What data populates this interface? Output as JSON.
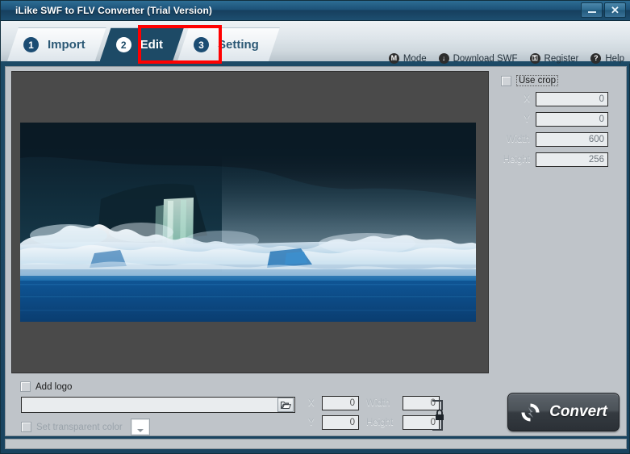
{
  "window": {
    "title": "iLike SWF to FLV Converter (Trial Version)",
    "minimize_label": "–",
    "close_label": "✕"
  },
  "tabs": [
    {
      "num": "1",
      "label": "Import",
      "active": false
    },
    {
      "num": "2",
      "label": "Edit",
      "active": true
    },
    {
      "num": "3",
      "label": "Setting",
      "active": false
    }
  ],
  "header_menu": [
    {
      "icon": "mode-icon",
      "glyph": "M",
      "label": "Mode"
    },
    {
      "icon": "download-icon",
      "glyph": "↓",
      "label": "Download SWF"
    },
    {
      "icon": "register-icon",
      "glyph": "⚿",
      "label": "Register"
    },
    {
      "icon": "help-icon",
      "glyph": "?",
      "label": "Help"
    }
  ],
  "crop": {
    "use_crop_label": "Use crop",
    "use_crop_checked": false,
    "fields": [
      {
        "label": "X",
        "value": "0"
      },
      {
        "label": "Y",
        "value": "0"
      },
      {
        "label": "Width",
        "value": "600"
      },
      {
        "label": "Height",
        "value": "256"
      }
    ]
  },
  "logo": {
    "add_logo_label": "Add logo",
    "add_logo_checked": false,
    "path_value": "",
    "path_placeholder": "",
    "browse_icon": "open-folder-icon",
    "transparent_label": "Set transparent color",
    "transparent_checked": false,
    "swatch_color": "#ffffff",
    "coords": [
      {
        "label": "X",
        "value": "0"
      },
      {
        "label": "Width",
        "value": "0"
      },
      {
        "label": "Y",
        "value": "0"
      },
      {
        "label": "Height",
        "value": "0"
      }
    ],
    "lock_icon": "lock-aspect-ratio-icon"
  },
  "convert": {
    "label": "Convert",
    "icon": "convert-refresh-icon"
  },
  "preview": {
    "alt": "glacier-waterfall-video-frame"
  },
  "colors": {
    "titlebar": "#1d5278",
    "accent": "#1d4a66",
    "highlight": "#ff0000",
    "panel": "#bfc4c9",
    "preview_bg": "#4a4a4a"
  }
}
